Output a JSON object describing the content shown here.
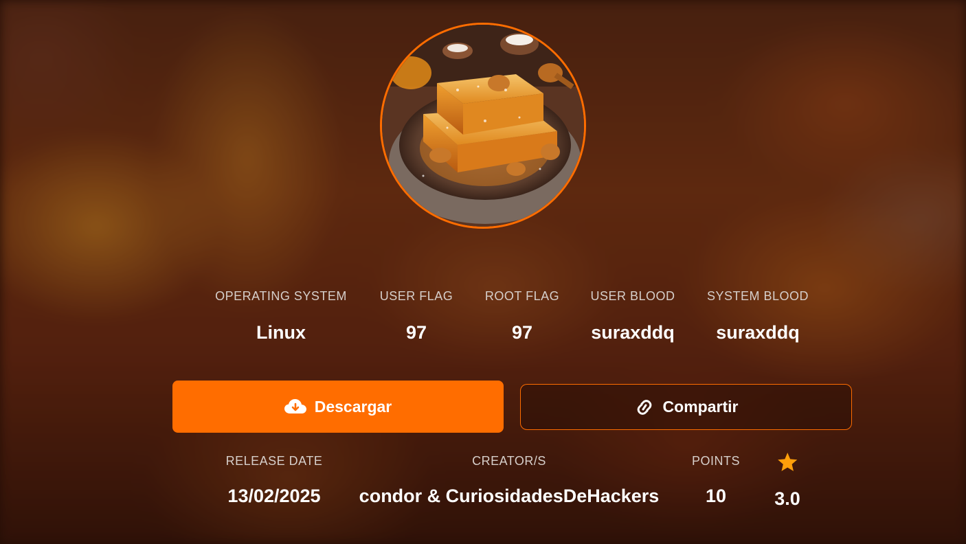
{
  "stats": {
    "operating_system": {
      "label": "OPERATING SYSTEM",
      "value": "Linux"
    },
    "user_flag": {
      "label": "USER FLAG",
      "value": "97"
    },
    "root_flag": {
      "label": "ROOT FLAG",
      "value": "97"
    },
    "user_blood": {
      "label": "USER BLOOD",
      "value": "suraxddq"
    },
    "system_blood": {
      "label": "SYSTEM BLOOD",
      "value": "suraxddq"
    }
  },
  "actions": {
    "download_label": "Descargar",
    "download_icon": "cloud-download-icon",
    "share_label": "Compartir",
    "share_icon": "link-icon"
  },
  "info": {
    "release_date": {
      "label": "RELEASE DATE",
      "value": "13/02/2025"
    },
    "creators": {
      "label": "CREATOR/S",
      "value": "condor & CuriosidadesDeHackers"
    },
    "points": {
      "label": "POINTS",
      "value": "10"
    },
    "rating": {
      "icon": "star-icon",
      "value": "3.0"
    }
  },
  "colors": {
    "accent": "#ff6d00",
    "label": "#d6cfcb",
    "value": "#ffffff"
  }
}
